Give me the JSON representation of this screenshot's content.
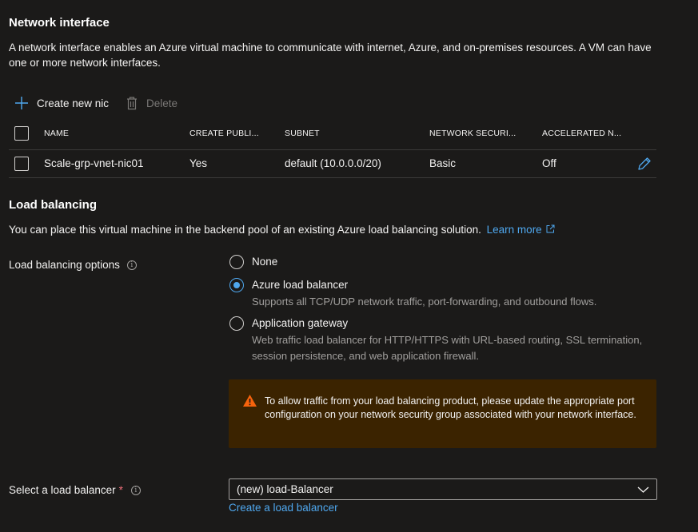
{
  "network_interface": {
    "title": "Network interface",
    "description": "A network interface enables an Azure virtual machine to communicate with internet, Azure, and on-premises resources. A VM can have one or more network interfaces.",
    "toolbar": {
      "create_label": "Create new nic",
      "delete_label": "Delete"
    },
    "table": {
      "headers": [
        "NAME",
        "CREATE PUBLI...",
        "SUBNET",
        "NETWORK SECURI...",
        "ACCELERATED N..."
      ],
      "rows": [
        {
          "name": "Scale-grp-vnet-nic01",
          "create_public": "Yes",
          "subnet": "default (10.0.0.0/20)",
          "nsg": "Basic",
          "accelerated": "Off"
        }
      ]
    }
  },
  "load_balancing": {
    "title": "Load balancing",
    "description": "You can place this virtual machine in the backend pool of an existing Azure load balancing solution.",
    "learn_more": "Learn more",
    "options_label": "Load balancing options",
    "options": [
      {
        "label": "None",
        "description": "",
        "selected": false
      },
      {
        "label": "Azure load balancer",
        "description": "Supports all TCP/UDP network traffic, port-forwarding, and outbound flows.",
        "selected": true
      },
      {
        "label": "Application gateway",
        "description": "Web traffic load balancer for HTTP/HTTPS with URL-based routing, SSL termination, session persistence, and web application firewall.",
        "selected": false
      }
    ],
    "warning": "To allow traffic from your load balancing product, please update the appropriate port configuration on your network security group associated with your network interface.",
    "select_label": "Select a load balancer",
    "required_marker": "*",
    "select_value": "(new) load-Balancer",
    "create_link": "Create a load balancer"
  },
  "colors": {
    "accent": "#4fa8ef",
    "warning_bg": "#3b2300",
    "warning_icon": "#f7630c"
  }
}
